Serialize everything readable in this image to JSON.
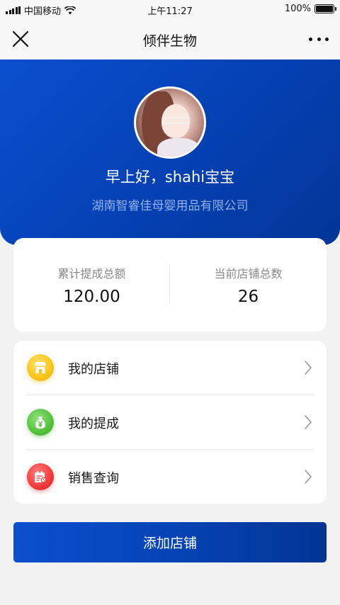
{
  "status_bar": {
    "carrier": "中国移动",
    "time": "上午11:27",
    "battery": "100%",
    "battery_level": 1.0
  },
  "nav": {
    "title": "倾伴生物",
    "close_icon": "close-icon",
    "more_icon": "more-icon"
  },
  "profile": {
    "greeting": "早上好，shahi宝宝",
    "company": "湖南智睿佳母婴用品有限公司"
  },
  "stats": {
    "total_commission_label": "累计提成总额",
    "total_commission_value": "120.00",
    "store_count_label": "当前店铺总数",
    "store_count_value": "26"
  },
  "menu": {
    "items": [
      {
        "label": "我的店铺",
        "icon": "store-icon",
        "color": "#f7c51a"
      },
      {
        "label": "我的提成",
        "icon": "money-bag-icon",
        "color": "#52c23a"
      },
      {
        "label": "销售查询",
        "icon": "calendar-search-icon",
        "color": "#f23a3a"
      }
    ]
  },
  "actions": {
    "add_store_label": "添加店铺"
  },
  "colors": {
    "primary": "#0544b6",
    "background": "#f2f2f2"
  }
}
